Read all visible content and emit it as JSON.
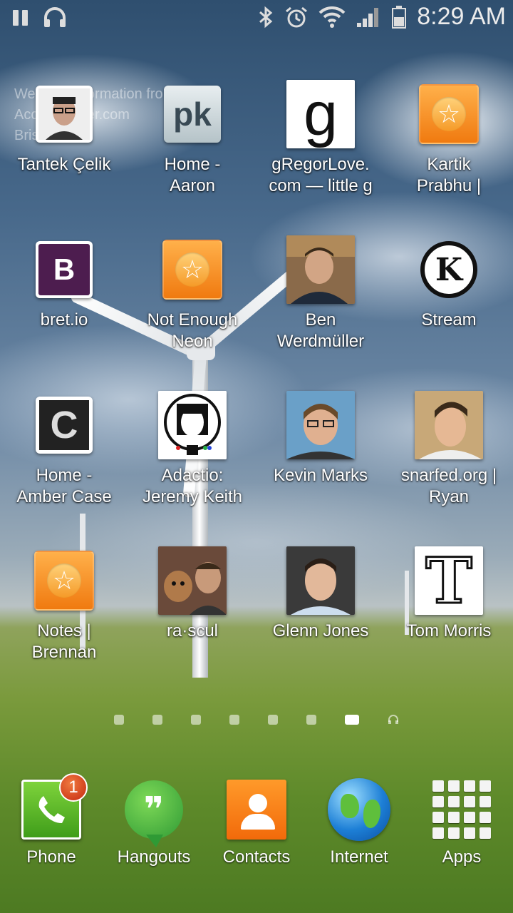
{
  "status_bar": {
    "time": "8:29 AM",
    "icons_left": [
      "pause-icon",
      "headphones-icon"
    ],
    "icons_right": [
      "bluetooth-icon",
      "alarm-icon",
      "wifi-icon",
      "signal-icon",
      "battery-icon"
    ]
  },
  "widget_overlay": {
    "lines": [
      "Weather information from",
      "AccuWeather.com",
      "Brisbane"
    ]
  },
  "home_grid": [
    {
      "label": "Tantek Çelik",
      "icon": "person-photo"
    },
    {
      "label": "Home -\nAaron",
      "icon": "pk-icon"
    },
    {
      "label": "gRegorLove.\ncom — little g",
      "icon": "g-letter-icon"
    },
    {
      "label": "Kartik\nPrabhu |",
      "icon": "star-bookmark-icon"
    },
    {
      "label": "bret.io",
      "icon": "b-letter-icon"
    },
    {
      "label": "Not Enough\nNeon",
      "icon": "star-bookmark-icon"
    },
    {
      "label": "Ben\nWerdmüller",
      "icon": "person-photo"
    },
    {
      "label": "Stream",
      "icon": "k-circle-icon"
    },
    {
      "label": "Home -\nAmber Case",
      "icon": "c-letter-icon"
    },
    {
      "label": "Adactio:\nJeremy Keith",
      "icon": "astronaut-icon"
    },
    {
      "label": "Kevin Marks",
      "icon": "person-photo"
    },
    {
      "label": "snarfed.org |\nRyan",
      "icon": "person-photo"
    },
    {
      "label": "Notes |\nBrennan",
      "icon": "star-bookmark-icon"
    },
    {
      "label": "ra·scul",
      "icon": "person-dog-photo"
    },
    {
      "label": "Glenn Jones",
      "icon": "person-photo"
    },
    {
      "label": "Tom Morris",
      "icon": "t-letter-icon"
    }
  ],
  "page_indicator": {
    "total_pages": 7,
    "current_page": 7,
    "extra": "headphones-icon"
  },
  "dock": [
    {
      "label": "Phone",
      "icon": "phone-icon",
      "badge": "1"
    },
    {
      "label": "Hangouts",
      "icon": "hangouts-icon"
    },
    {
      "label": "Contacts",
      "icon": "contacts-icon"
    },
    {
      "label": "Internet",
      "icon": "globe-icon"
    },
    {
      "label": "Apps",
      "icon": "apps-grid-icon"
    }
  ]
}
